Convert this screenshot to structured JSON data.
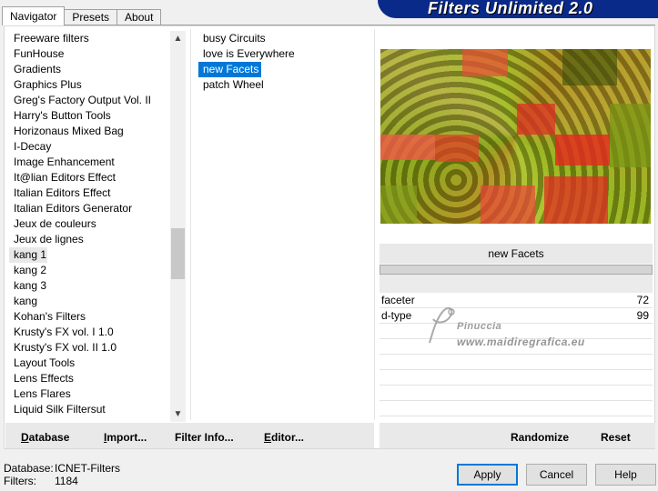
{
  "tabs": [
    {
      "label": "Navigator",
      "active": true
    },
    {
      "label": "Presets",
      "active": false
    },
    {
      "label": "About",
      "active": false
    }
  ],
  "banner_title": "Filters Unlimited 2.0",
  "categories": [
    "Freeware filters",
    "FunHouse",
    "Gradients",
    "Graphics Plus",
    "Greg's Factory Output Vol. II",
    "Harry's Button Tools",
    "Horizonaus Mixed Bag",
    "I-Decay",
    "Image Enhancement",
    "It@lian Editors Effect",
    "Italian Editors Effect",
    "Italian Editors Generator",
    "Jeux de couleurs",
    "Jeux de lignes",
    "kang 1",
    "kang 2",
    "kang 3",
    "kang",
    "Kohan's Filters",
    "Krusty's FX vol. I 1.0",
    "Krusty's FX vol. II 1.0",
    "Layout Tools",
    "Lens Effects",
    "Lens Flares",
    "Liquid Silk Filtersut"
  ],
  "selected_category": "kang 1",
  "filters": [
    "busy Circuits",
    "love is Everywhere",
    "new Facets",
    "patch Wheel"
  ],
  "selected_filter": "new Facets",
  "filter_name": "new Facets",
  "params": [
    {
      "label": "faceter",
      "value": "72"
    },
    {
      "label": "d-type",
      "value": "99"
    }
  ],
  "watermark": {
    "line1": "Pinuccia",
    "line2": "www.maidiregrafica.eu"
  },
  "actions_left": [
    {
      "key": "D",
      "rest": "atabase"
    },
    {
      "key": "I",
      "rest": "mport..."
    },
    {
      "key": "",
      "rest": "Filter Info..."
    },
    {
      "key": "E",
      "rest": "ditor..."
    }
  ],
  "actions_right": {
    "randomize": "Randomize",
    "reset": "Reset"
  },
  "status": {
    "database_label": "Database:",
    "database_value": "ICNET-Filters",
    "filters_label": "Filters:",
    "filters_value": "1184"
  },
  "buttons": {
    "apply": "Apply",
    "cancel": "Cancel",
    "help": "Help"
  },
  "colors": {
    "accent": "#0078d7",
    "banner": "#0a2a8a"
  }
}
